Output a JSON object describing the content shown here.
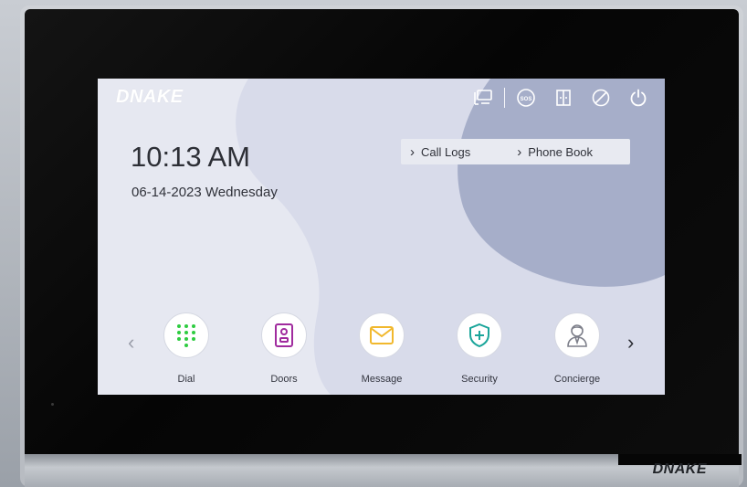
{
  "brand": {
    "screen_logo": "DNAKE",
    "bezel_logo": "DNAKE"
  },
  "status_bar": {
    "icons": [
      "monitor-icon",
      "sos-icon",
      "door-icon",
      "do-not-disturb-icon",
      "power-icon"
    ],
    "sos_text": "SOS"
  },
  "clock": {
    "time": "10:13 AM",
    "date": "06-14-2023 Wednesday"
  },
  "quick_links": {
    "call_logs": "Call Logs",
    "phone_book": "Phone Book"
  },
  "apps": [
    {
      "label": "Dial",
      "icon": "dialpad-icon",
      "color": "#2ecc40"
    },
    {
      "label": "Doors",
      "icon": "door-station-icon",
      "color": "#a02b9e"
    },
    {
      "label": "Message",
      "icon": "envelope-icon",
      "color": "#f1b82d"
    },
    {
      "label": "Security",
      "icon": "shield-plus-icon",
      "color": "#1aa59a"
    },
    {
      "label": "Concierge",
      "icon": "concierge-icon",
      "color": "#7d7f8a"
    }
  ],
  "nav": {
    "prev": "‹",
    "next": "›"
  },
  "colors": {
    "screen_bg": "#e6e8f1",
    "wave_light": "#d8dbea",
    "wave_dark": "#a6aec9",
    "bezel": "#0a0a0a"
  }
}
